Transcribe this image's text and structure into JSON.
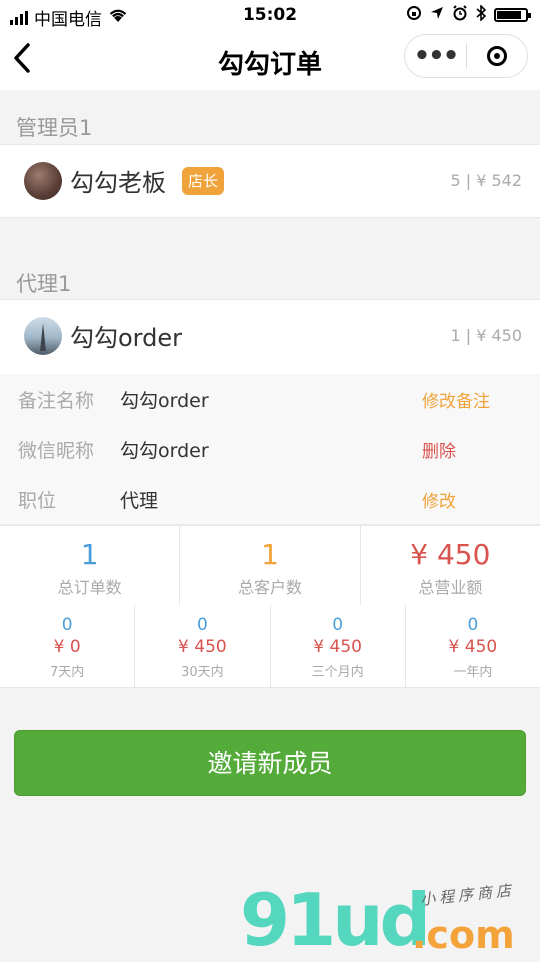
{
  "status_bar": {
    "carrier": "中国电信",
    "time": "15:02"
  },
  "nav": {
    "title": "勾勾订单",
    "more_glyph": "•••"
  },
  "sections": [
    {
      "label": "管理员1",
      "member": {
        "name": "勾勾老板",
        "badge": "店长",
        "stat": "5 |  ¥ 542"
      }
    },
    {
      "label": "代理1",
      "member": {
        "name": "勾勾order",
        "stat": "1 |  ¥ 450"
      }
    }
  ],
  "details": [
    {
      "label": "备注名称",
      "value": "勾勾order",
      "action": "修改备注",
      "action_color": "#f0a33a"
    },
    {
      "label": "微信昵称",
      "value": "勾勾order",
      "action": "删除",
      "action_color": "#d9534f"
    },
    {
      "label": "职位",
      "value": "代理",
      "action": "修改",
      "action_color": "#f0a33a"
    }
  ],
  "stats_big": [
    {
      "value": "1",
      "label": "总订单数"
    },
    {
      "value": "1",
      "label": "总客户数"
    },
    {
      "value": "¥ 450",
      "label": "总营业额"
    }
  ],
  "stats_small": [
    {
      "count": "0",
      "amount": "¥ 0",
      "label": "7天内"
    },
    {
      "count": "0",
      "amount": "¥ 450",
      "label": "30天内"
    },
    {
      "count": "0",
      "amount": "¥ 450",
      "label": "三个月内"
    },
    {
      "count": "0",
      "amount": "¥ 450",
      "label": "一年内"
    }
  ],
  "invite_button": "邀请新成员",
  "watermark": {
    "main": "91ud",
    "sub": ".com",
    "tag": "小程序商店"
  },
  "colors": {
    "accent_green": "#55ab3a",
    "badge_orange": "#f0a33a",
    "danger_red": "#d9534f",
    "count_blue": "#4a9fd8"
  }
}
